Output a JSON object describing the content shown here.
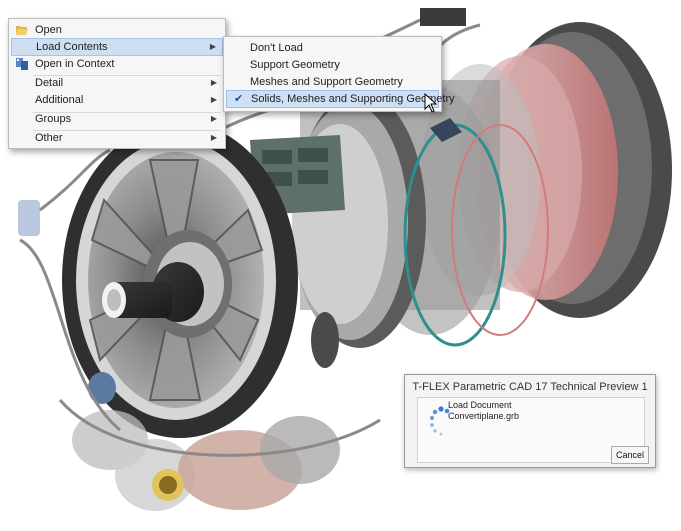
{
  "context_menu": {
    "items": [
      {
        "label": "Open",
        "icon": "folder-open-icon"
      },
      {
        "label": "Load Contents",
        "has_submenu": true,
        "highlighted": true
      },
      {
        "label": "Open in Context",
        "icon": "open-in-context-icon"
      },
      {
        "label": "Detail",
        "has_submenu": true
      },
      {
        "label": "Additional",
        "has_submenu": true
      },
      {
        "label": "Groups",
        "has_submenu": true
      },
      {
        "label": "Other",
        "has_submenu": true
      }
    ]
  },
  "submenu": {
    "items": [
      {
        "label": "Don't Load"
      },
      {
        "label": "Support Geometry"
      },
      {
        "label": "Meshes and Support Geometry"
      },
      {
        "label": "Solids, Meshes and Supporting Geometry",
        "checked": true,
        "highlighted": true
      }
    ]
  },
  "dialog": {
    "title": "T-FLEX Parametric CAD 17 Technical Preview 1",
    "status_label": "Load Document",
    "file_name": "Convertiplane.grb",
    "cancel_label": "Cancel"
  },
  "colors": {
    "menu_highlight": "#cfdff2",
    "spinner": "#2f7fd1"
  }
}
